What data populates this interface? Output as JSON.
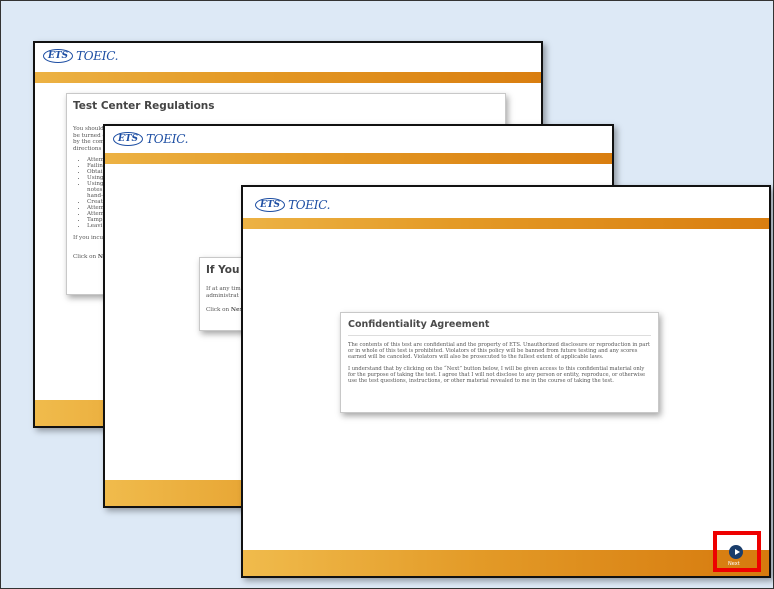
{
  "brand": {
    "ets": "ETS",
    "product": "TOEIC."
  },
  "screen1": {
    "title": "Test Center Regulations",
    "intro_lines": [
      "You should",
      "be turned o",
      "by the com",
      "directions o"
    ],
    "rules": [
      "Attem",
      "Failing",
      "Obtai",
      "Using",
      "Using",
      "notes",
      "hand-",
      "Create",
      "Attem",
      "Attem",
      "Tamp",
      "Leavi"
    ],
    "outro": "If you incu",
    "click_prefix": "Click on ",
    "click_bold": "Ne"
  },
  "screen2": {
    "title": "If You I",
    "lines": [
      "If at any tim",
      "administrat"
    ],
    "click_prefix": "Click on ",
    "click_bold": "Nex"
  },
  "screen3": {
    "title": "Confidentiality Agreement",
    "paragraph1": "The contents of this test are confidential and the property of ETS. Unauthorized disclosure or reproduction in part or in whole of this test is prohibited. Violators of this policy will be banned from future testing and any scores earned will be canceled. Violators will also be prosecuted to the fullest extent of applicable laws.",
    "paragraph2": "I understand that by clicking on the “Next” button below, I will be given access to this confidential material only for the purpose of taking the test. I agree that I will not disclose to any person or entity, reproduce, or otherwise use the test questions, instructions, or other material revealed to me in the course of taking the test.",
    "next_label": "Next"
  },
  "icons": {
    "next": "next-arrow-icon"
  },
  "colors": {
    "highlight": "#ee0000",
    "brand_blue": "#1d4ea3",
    "bar_orange": "#e49a26"
  }
}
